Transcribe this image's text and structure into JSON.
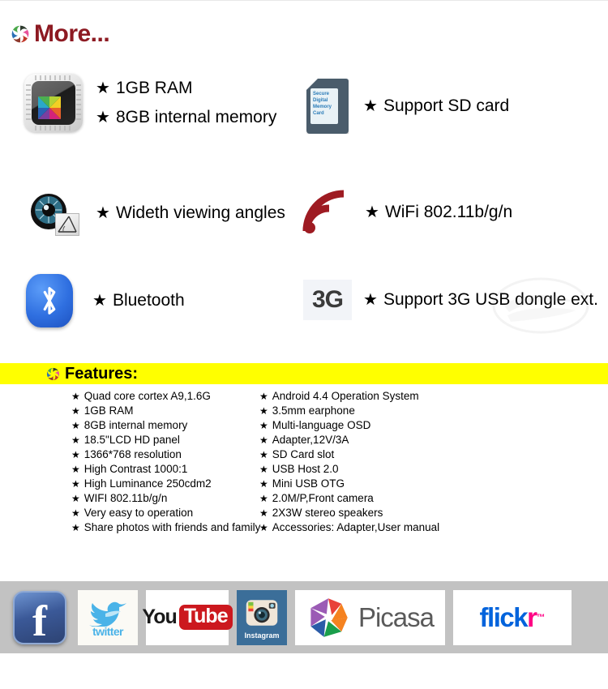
{
  "header": {
    "title": "More...",
    "logo_icon": "pinwheel-icon",
    "title_color": "#8d1a22"
  },
  "specs": [
    {
      "icon": "memory-chip-icon",
      "lines": [
        "1GB RAM",
        "8GB internal memory"
      ]
    },
    {
      "icon": "sd-card-icon",
      "sd_label": "Secure Digital Memory Card",
      "lines": [
        "Support SD card"
      ]
    },
    {
      "icon": "viewing-angle-eye-icon",
      "lines": [
        "Wideth viewing angles"
      ]
    },
    {
      "icon": "wifi-icon",
      "lines": [
        "WiFi  802.11b/g/n"
      ]
    },
    {
      "icon": "bluetooth-icon",
      "lines": [
        "Bluetooth"
      ]
    },
    {
      "icon": "3g-icon",
      "icon_label": "3G",
      "lines": [
        "Support 3G USB dongle ext."
      ]
    }
  ],
  "features": {
    "banner_title": "Features:",
    "banner_icon": "pinwheel-icon",
    "banner_color": "#ffff00",
    "left_column": [
      "Quad core cortex A9,1.6G",
      "1GB RAM",
      "8GB internal memory",
      "18.5\"LCD HD panel",
      "1366*768 resolution",
      "High Contrast 1000:1",
      "High Luminance 250cdm2",
      "WIFI 802.11b/g/n",
      "Very easy to operation",
      "Share photos with friends and family"
    ],
    "right_column": [
      "Android 4.4 Operation System",
      "3.5mm earphone",
      "Multi-language OSD",
      "Adapter,12V/3A",
      "SD Card slot",
      "USB Host 2.0",
      "Mini USB OTG",
      "2.0M/P,Front camera",
      "2X3W stereo speakers",
      "Accessories: Adapter,User manual"
    ]
  },
  "social": {
    "bar_color": "#c2c2c2",
    "items": [
      {
        "name": "facebook",
        "icon": "facebook-icon",
        "label": "f"
      },
      {
        "name": "twitter",
        "icon": "twitter-bird-icon",
        "label": "twitter"
      },
      {
        "name": "youtube",
        "icon": "youtube-icon",
        "label_you": "You",
        "label_tube": "Tube"
      },
      {
        "name": "instagram",
        "icon": "instagram-camera-icon",
        "label": "Instagram"
      },
      {
        "name": "picasa",
        "icon": "picasa-shutter-icon",
        "label": "Picasa"
      },
      {
        "name": "flickr",
        "icon": "flickr-icon",
        "label_blue": "flick",
        "label_pink": "r",
        "label_tm": "™"
      }
    ]
  },
  "star_glyph": "★"
}
